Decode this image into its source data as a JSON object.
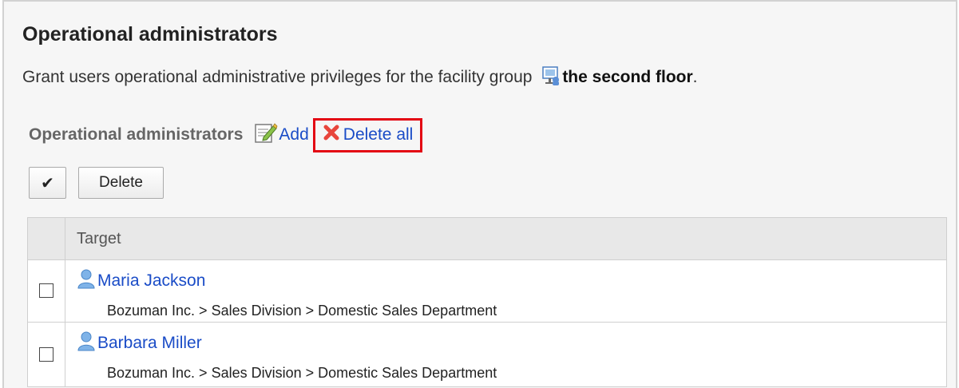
{
  "header": {
    "title": "Operational administrators",
    "description": "Grant users operational administrative privileges for the facility group ",
    "facility_group": "the second floor",
    "description_end": "."
  },
  "section": {
    "title": "Operational administrators",
    "add_label": "Add",
    "delete_all_label": "Delete all",
    "highlight_color": "#e30613"
  },
  "toolbar": {
    "check_all_label": "✔",
    "delete_label": "Delete"
  },
  "table": {
    "column_header": "Target",
    "rows": [
      {
        "name": "Maria Jackson",
        "org_path": "Bozuman Inc. > Sales Division > Domestic Sales Department",
        "checked": false
      },
      {
        "name": "Barbara Miller",
        "org_path": "Bozuman Inc. > Sales Division > Domestic Sales Department",
        "checked": false
      }
    ]
  },
  "icons": {
    "facility": "facility-group-icon",
    "add": "add-pencil-icon",
    "delete_all": "red-x-icon",
    "user": "user-icon"
  },
  "colors": {
    "link": "#1a4cc7",
    "panel_bg": "#f6f6f6",
    "header_bg": "#e8e8e8"
  }
}
